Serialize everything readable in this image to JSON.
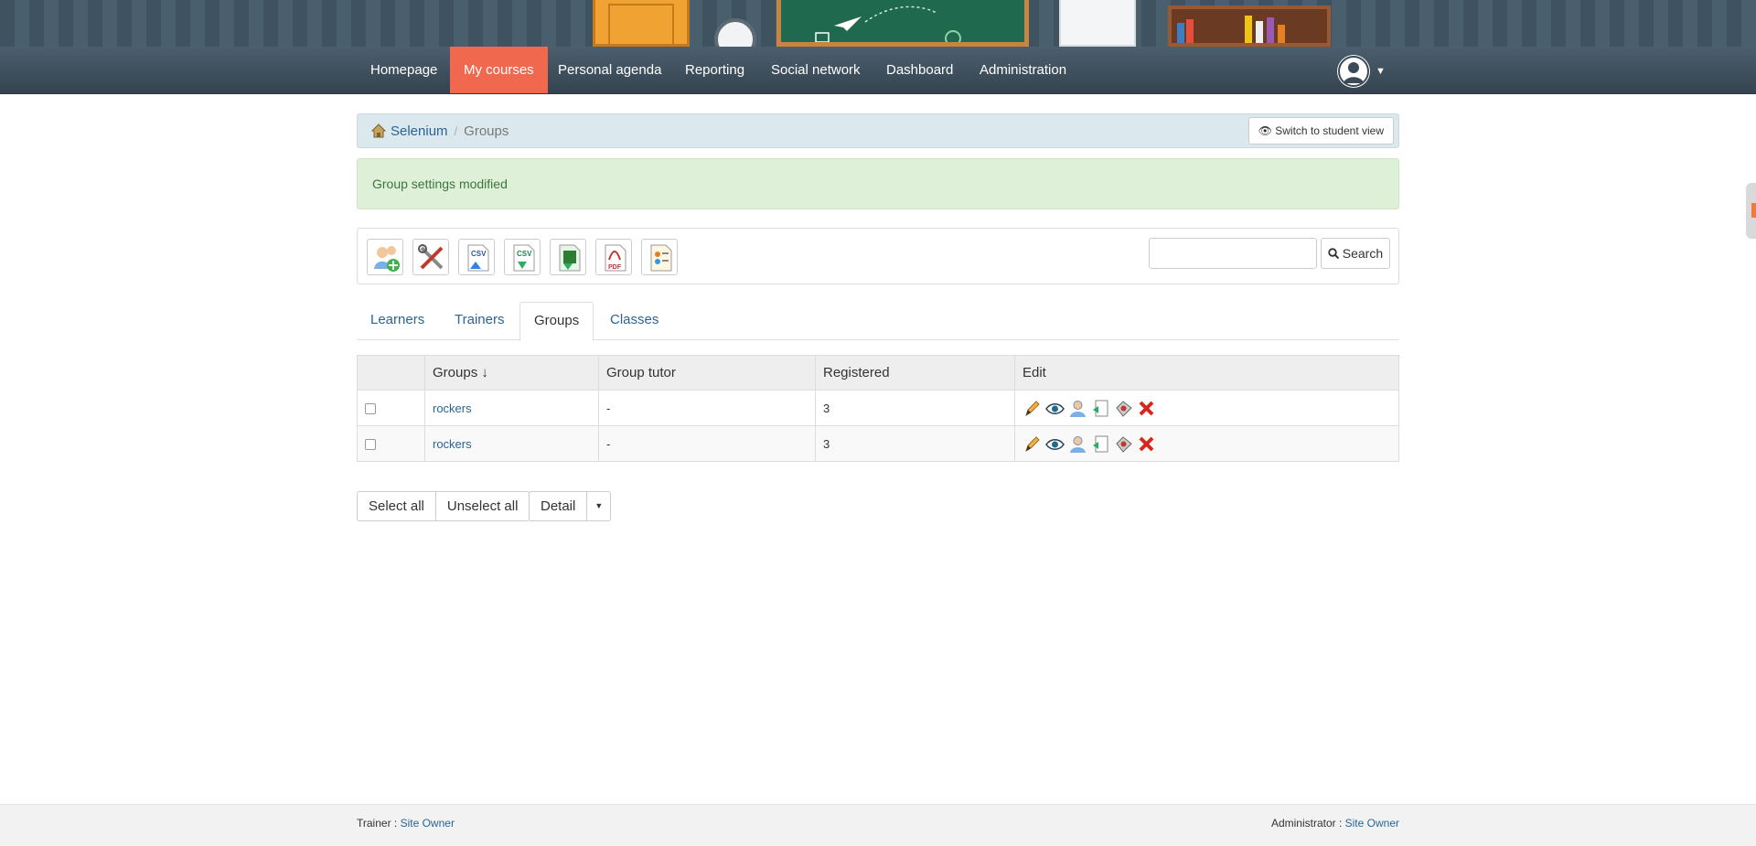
{
  "nav": {
    "items": [
      {
        "label": "Homepage"
      },
      {
        "label": "My courses"
      },
      {
        "label": "Personal agenda"
      },
      {
        "label": "Reporting"
      },
      {
        "label": "Social network"
      },
      {
        "label": "Dashboard"
      },
      {
        "label": "Administration"
      }
    ],
    "active": "My courses"
  },
  "breadcrumb": {
    "course": "Selenium",
    "current": "Groups",
    "student_view_label": "Switch to student view"
  },
  "alert": {
    "message": "Group settings modified"
  },
  "toolbar": {
    "icons": [
      "add-group-icon",
      "group-settings-icon",
      "import-csv-icon",
      "export-csv-icon",
      "export-excel-icon",
      "export-pdf-icon",
      "group-overview-icon"
    ],
    "search_label": "Search",
    "search_value": ""
  },
  "tabs": [
    {
      "label": "Learners"
    },
    {
      "label": "Trainers"
    },
    {
      "label": "Groups"
    },
    {
      "label": "Classes"
    }
  ],
  "active_tab": "Groups",
  "table": {
    "headers": {
      "groups": "Groups ↓",
      "tutor": "Group tutor",
      "registered": "Registered",
      "edit": "Edit"
    },
    "rows": [
      {
        "name": "rockers",
        "tutor": "-",
        "registered": "3"
      },
      {
        "name": "rockers",
        "tutor": "-",
        "registered": "3"
      }
    ],
    "row_actions": [
      "edit-icon",
      "view-icon",
      "members-icon",
      "export-icon",
      "settings-icon",
      "delete-icon"
    ]
  },
  "actions": {
    "select_all": "Select all",
    "unselect_all": "Unselect all",
    "detail": "Detail"
  },
  "footer": {
    "trainer_label": "Trainer : ",
    "trainer_name": "Site Owner",
    "admin_label": "Administrator : ",
    "admin_name": "Site Owner"
  },
  "colors": {
    "nav_active": "#f0694f",
    "alert_bg": "#dff0d8",
    "link": "#2a6496"
  }
}
